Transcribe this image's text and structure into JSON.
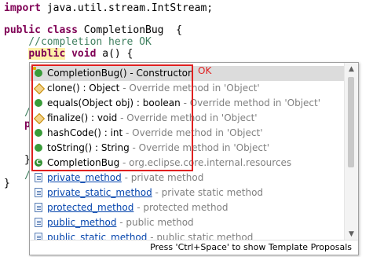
{
  "code": {
    "line1": "import java.util.stream.IntStream;",
    "line2_kw1": "public",
    "line2_kw2": "class",
    "line2_rest": " CompletionBug  {",
    "line3": "    //completion here OK",
    "line4_kw1": "public",
    "line4_kw2": "void",
    "line4_rest": " a() {",
    "line_p1": "p",
    "line_p2": "p",
    "line_slash1": "/",
    "line_slash2": "/",
    "line_brace1": "}",
    "line_brace2": "}"
  },
  "popup": {
    "ok_label": "OK",
    "items": [
      {
        "name": "CompletionBug()",
        "desc": " - Constructor",
        "icon": "constructor-icon"
      },
      {
        "name": "clone() : Object",
        "desc": " - Override method in 'Object'",
        "icon": "protected-method-icon"
      },
      {
        "name": "equals(Object obj) : boolean",
        "desc": " - Override method in 'Object'",
        "icon": "public-method-icon"
      },
      {
        "name": "finalize() : void",
        "desc": " - Override method in 'Object'",
        "icon": "protected-method-icon"
      },
      {
        "name": "hashCode() : int",
        "desc": " - Override method in 'Object'",
        "icon": "public-method-icon"
      },
      {
        "name": "toString() : String",
        "desc": " - Override method in 'Object'",
        "icon": "public-method-icon"
      },
      {
        "name": "CompletionBug",
        "desc": " - org.eclipse.core.internal.resources",
        "icon": "class-icon"
      },
      {
        "name": "private_method",
        "desc": " - private method",
        "icon": "template-icon"
      },
      {
        "name": "private_static_method",
        "desc": " - private static method",
        "icon": "template-icon"
      },
      {
        "name": "protected_method",
        "desc": " - protected method",
        "icon": "template-icon"
      },
      {
        "name": "public_method",
        "desc": " - public method",
        "icon": "template-icon"
      },
      {
        "name": "public_static_method",
        "desc": " - public static method",
        "icon": "template-icon"
      }
    ],
    "footer": "Press 'Ctrl+Space' to show Template Proposals"
  }
}
